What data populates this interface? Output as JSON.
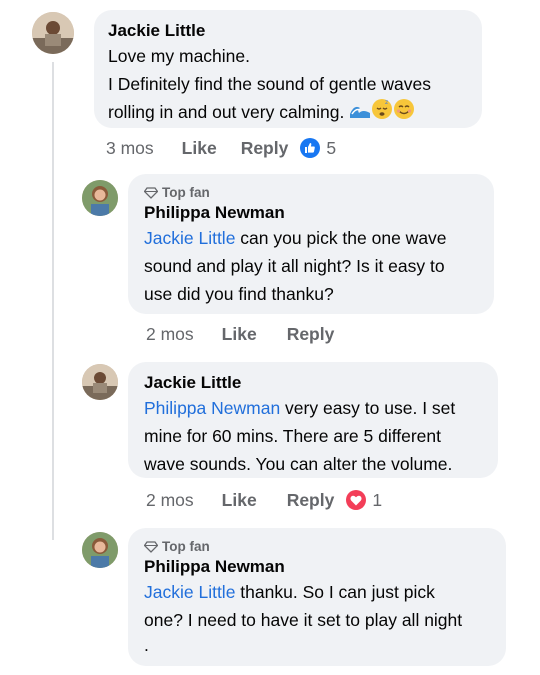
{
  "comments": [
    {
      "author": "Jackie Little",
      "lines": [
        "Love my machine.",
        "I Definitely find the sound of gentle waves",
        "rolling in and out very calming."
      ],
      "emojis": [
        "wave-icon",
        "sleeping-face-icon",
        "smiling-face-icon"
      ],
      "time": "3 mos",
      "like_label": "Like",
      "reply_label": "Reply",
      "reaction": {
        "type": "like",
        "count": "5",
        "color": "#1877f2"
      }
    },
    {
      "badge": "Top fan",
      "author": "Philippa Newman",
      "mention": "Jackie Little",
      "lines": [
        " can you pick the one wave",
        "sound and play it all night? Is it easy to",
        "use did you find thanku?"
      ],
      "time": "2 mos",
      "like_label": "Like",
      "reply_label": "Reply"
    },
    {
      "author": "Jackie Little",
      "mention": "Philippa Newman",
      "lines": [
        " very easy to use. I set",
        "mine for 60 mins. There are 5 different",
        "wave sounds. You can alter the volume."
      ],
      "time": "2 mos",
      "like_label": "Like",
      "reply_label": "Reply",
      "reaction": {
        "type": "love",
        "count": "1",
        "color": "#f33e58"
      }
    },
    {
      "badge": "Top fan",
      "author": "Philippa Newman",
      "mention": "Jackie Little",
      "lines": [
        " thanku. So I can just pick",
        "one? I need to have it set to play all night",
        "."
      ]
    }
  ],
  "colors": {
    "mention": "#216fdb",
    "bubble": "#f0f2f5",
    "meta": "#65676b"
  }
}
